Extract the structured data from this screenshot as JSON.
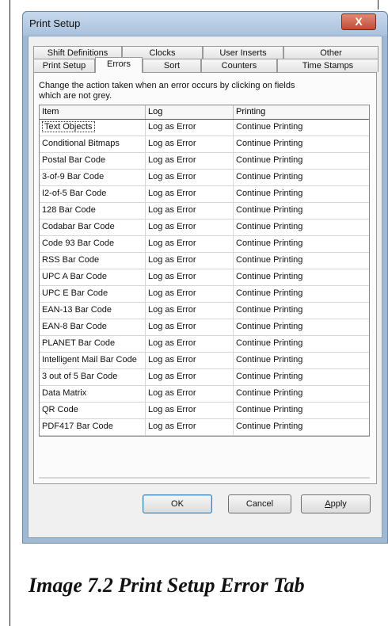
{
  "window": {
    "title": "Print Setup",
    "close_glyph": "X"
  },
  "tabs_row1": [
    "Shift Definitions",
    "Clocks",
    "User Inserts",
    "Other"
  ],
  "tabs_row2": [
    "Print Setup",
    "Errors",
    "Sort",
    "Counters",
    "Time Stamps"
  ],
  "active_tab": "Errors",
  "description": "Change the action taken when an error occurs by clicking on fields which are not grey.",
  "grid": {
    "headers": [
      "Item",
      "Log",
      "Printing"
    ],
    "rows": [
      [
        "Text Objects",
        "Log as Error",
        "Continue Printing"
      ],
      [
        "Conditional Bitmaps",
        "Log as Error",
        "Continue Printing"
      ],
      [
        "Postal Bar Code",
        "Log as Error",
        "Continue Printing"
      ],
      [
        "3-of-9 Bar Code",
        "Log as Error",
        "Continue Printing"
      ],
      [
        "I2-of-5 Bar Code",
        "Log as Error",
        "Continue Printing"
      ],
      [
        "128 Bar Code",
        "Log as Error",
        "Continue Printing"
      ],
      [
        "Codabar Bar Code",
        "Log as Error",
        "Continue Printing"
      ],
      [
        "Code 93 Bar Code",
        "Log as Error",
        "Continue Printing"
      ],
      [
        "RSS Bar Code",
        "Log as Error",
        "Continue Printing"
      ],
      [
        "UPC A Bar Code",
        "Log as Error",
        "Continue Printing"
      ],
      [
        "UPC E Bar Code",
        "Log as Error",
        "Continue Printing"
      ],
      [
        "EAN-13 Bar Code",
        "Log as Error",
        "Continue Printing"
      ],
      [
        "EAN-8 Bar Code",
        "Log as Error",
        "Continue Printing"
      ],
      [
        "PLANET Bar Code",
        "Log as Error",
        "Continue Printing"
      ],
      [
        "Intelligent Mail Bar Code",
        "Log as Error",
        "Continue Printing"
      ],
      [
        "3 out of 5 Bar Code",
        "Log as Error",
        "Continue Printing"
      ],
      [
        "Data Matrix",
        "Log as Error",
        "Continue Printing"
      ],
      [
        "QR Code",
        "Log as Error",
        "Continue Printing"
      ],
      [
        "PDF417 Bar Code",
        "Log as Error",
        "Continue Printing"
      ]
    ]
  },
  "buttons": {
    "ok": "OK",
    "cancel": "Cancel",
    "apply_prefix": "A",
    "apply_rest": "pply"
  },
  "caption": "Image 7.2 Print Setup Error Tab"
}
